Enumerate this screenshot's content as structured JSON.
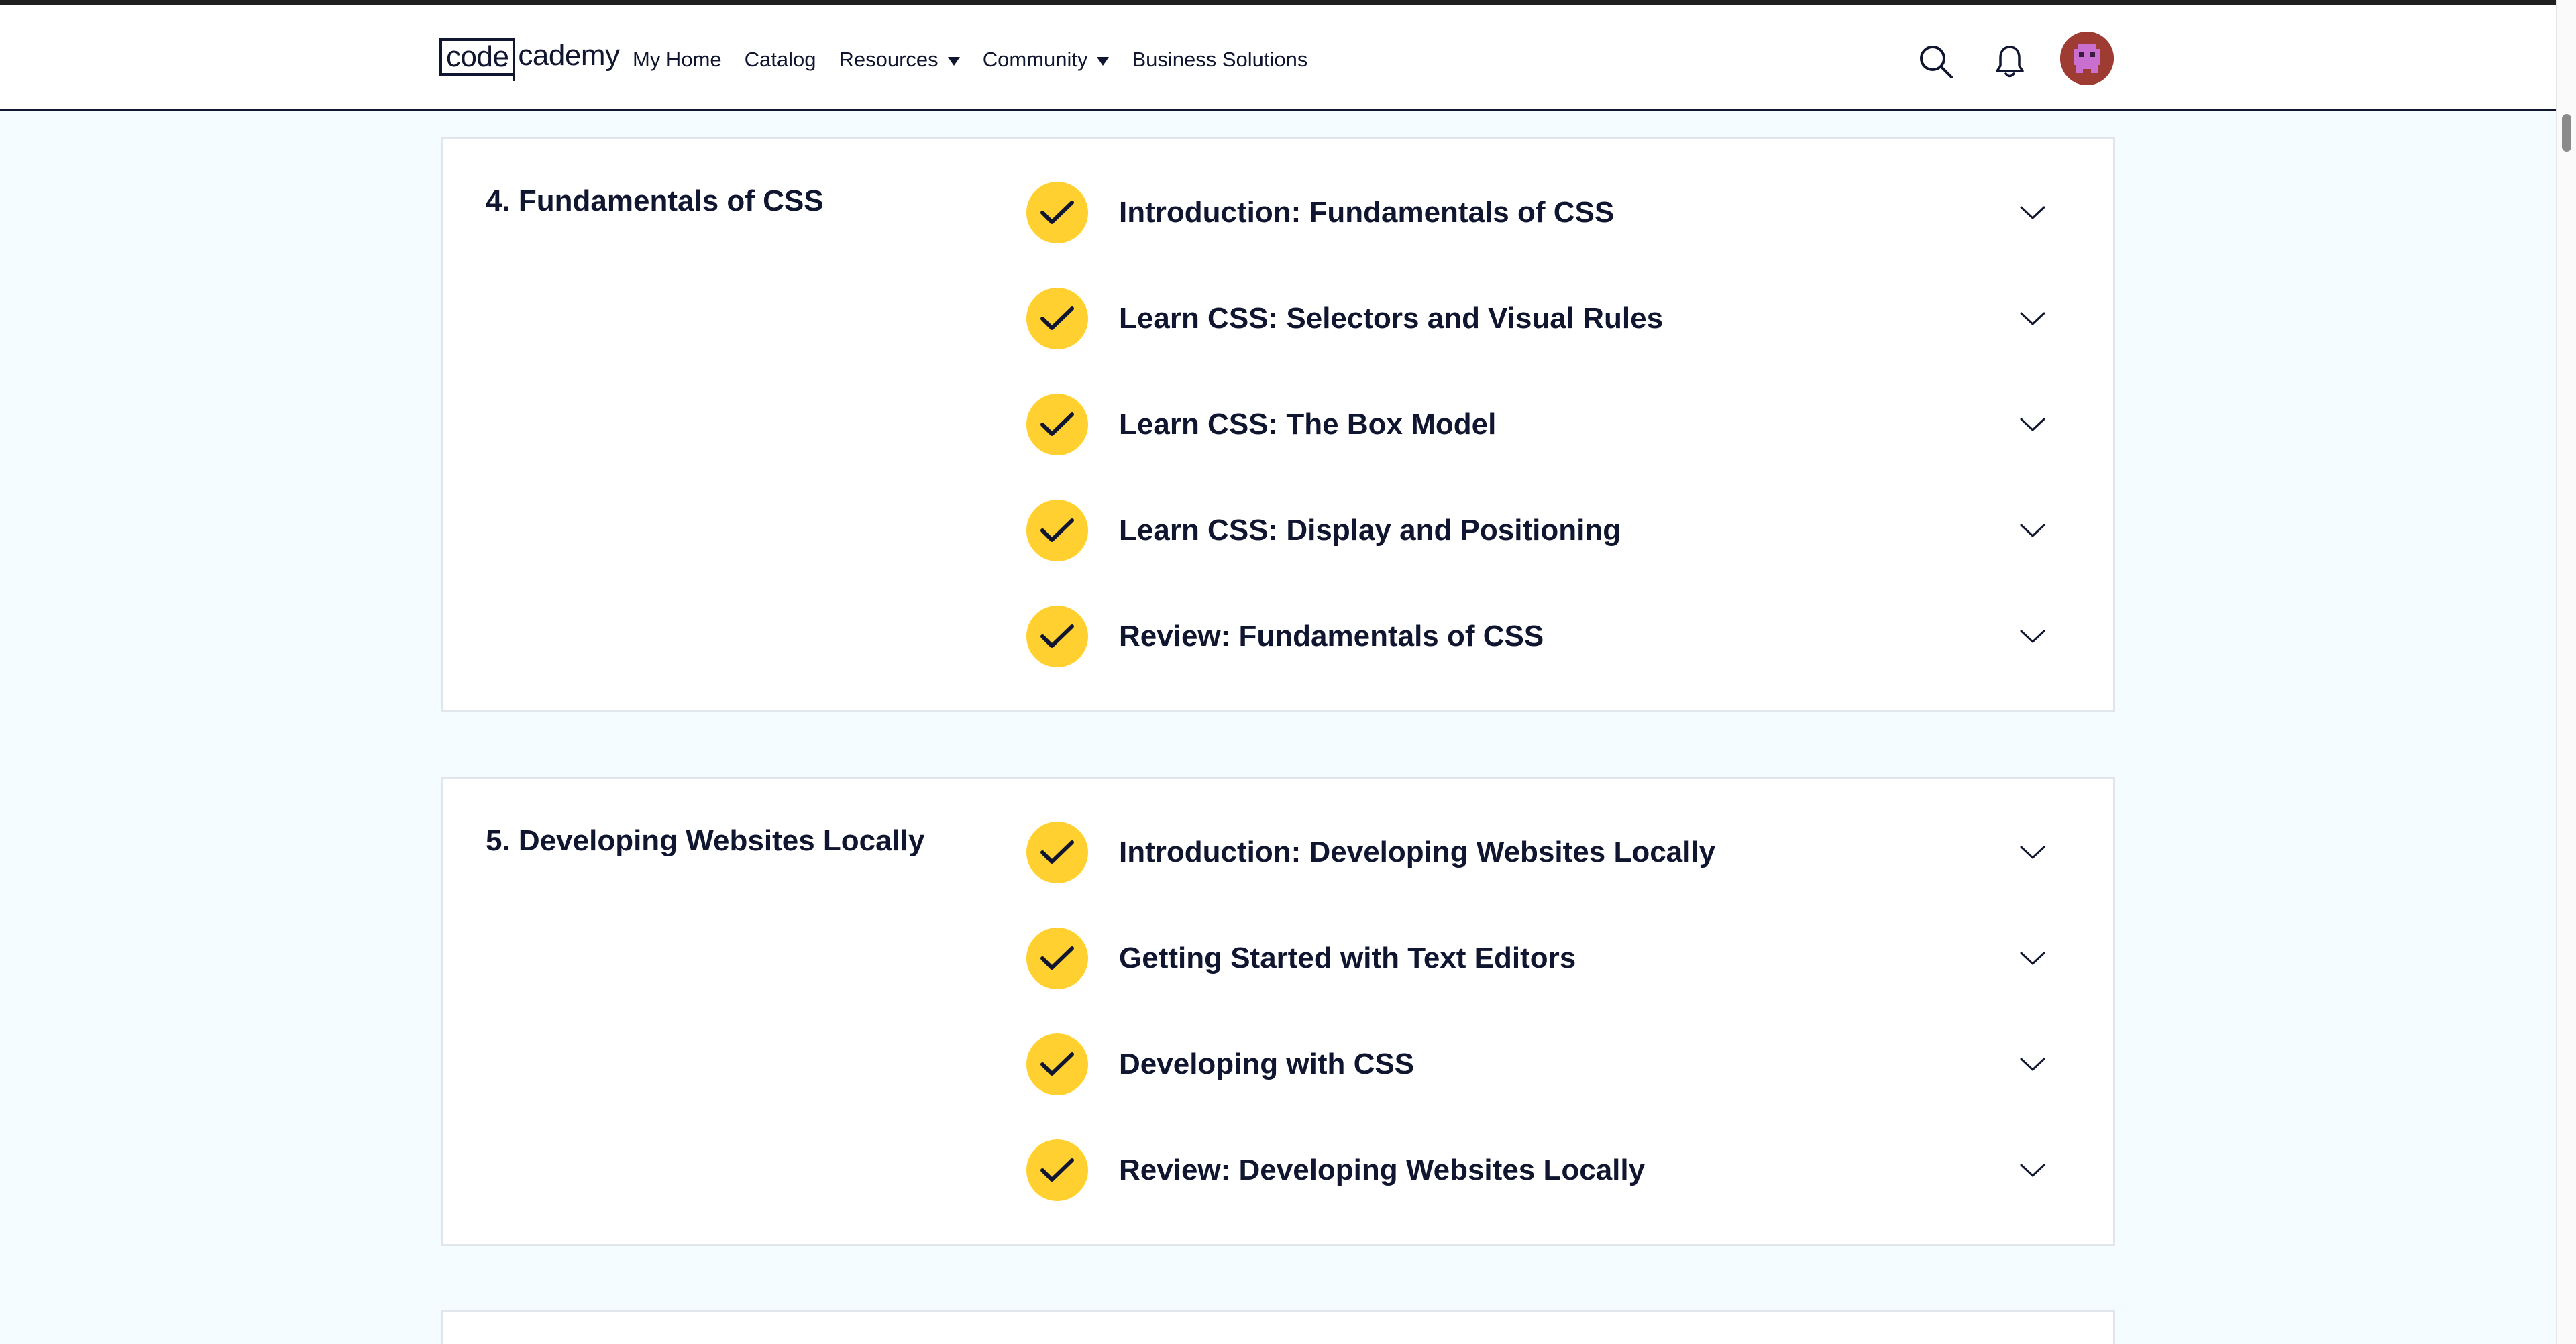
{
  "header": {
    "logo": {
      "part1": "code",
      "part2": "cademy"
    },
    "nav": [
      {
        "label": "My Home",
        "dropdown": false
      },
      {
        "label": "Catalog",
        "dropdown": false
      },
      {
        "label": "Resources",
        "dropdown": true
      },
      {
        "label": "Community",
        "dropdown": true
      },
      {
        "label": "Business Solutions",
        "dropdown": false
      }
    ],
    "icons": [
      "search-icon",
      "bell-icon",
      "avatar"
    ]
  },
  "colors": {
    "page_bg": "#f5fcff",
    "navy": "#10162f",
    "check_yellow": "#ffd02f",
    "card_border": "#e0e6ec"
  },
  "modules": [
    {
      "title": "4. Fundamentals of CSS",
      "lessons": [
        {
          "label": "Introduction: Fundamentals of CSS",
          "completed": true
        },
        {
          "label": "Learn CSS: Selectors and Visual Rules",
          "completed": true
        },
        {
          "label": "Learn CSS: The Box Model",
          "completed": true
        },
        {
          "label": "Learn CSS: Display and Positioning",
          "completed": true
        },
        {
          "label": "Review: Fundamentals of CSS",
          "completed": true
        }
      ]
    },
    {
      "title": "5. Developing Websites Locally",
      "lessons": [
        {
          "label": "Introduction: Developing Websites Locally",
          "completed": true
        },
        {
          "label": "Getting Started with Text Editors",
          "completed": true
        },
        {
          "label": "Developing with CSS",
          "completed": true
        },
        {
          "label": "Review: Developing Websites Locally",
          "completed": true
        }
      ]
    }
  ]
}
